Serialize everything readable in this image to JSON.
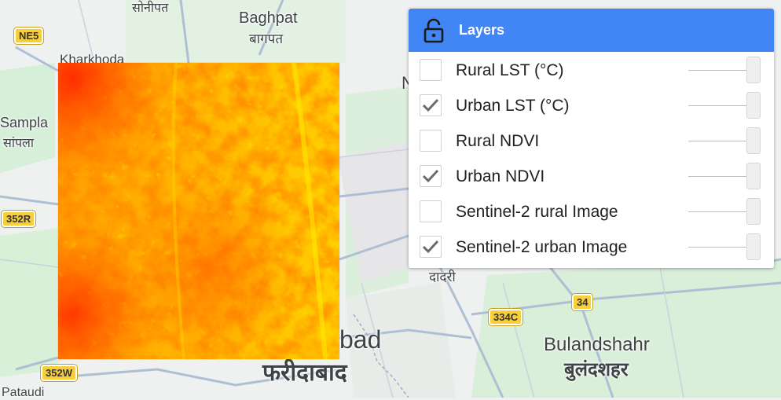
{
  "map": {
    "places": [
      {
        "name": "सोनीपत",
        "id": "sonipat-hi"
      },
      {
        "name": "Baghpat",
        "id": "baghpat"
      },
      {
        "name": "बागपत",
        "id": "baghpat-hi"
      },
      {
        "name": "Kharkhoda",
        "id": "kharkhoda"
      },
      {
        "name": "Sampla",
        "id": "sampla"
      },
      {
        "name": "सांपला",
        "id": "sampla-hi"
      },
      {
        "name": "Pataudi",
        "id": "pataudi"
      },
      {
        "name": "bad",
        "id": "faridabad-partial"
      },
      {
        "name": "फरीदाबाद",
        "id": "faridabad-hi"
      },
      {
        "name": "दादरी",
        "id": "dadri-hi"
      },
      {
        "name": "Bulandshahr",
        "id": "bulandshahr"
      },
      {
        "name": "बुलंदशहर",
        "id": "bulandshahr-hi"
      },
      {
        "name": "N",
        "id": "partial-n"
      }
    ],
    "shields": [
      "NE5",
      "352R",
      "352W",
      "334C",
      "34"
    ],
    "raster_colors": [
      "#ff1a00",
      "#ff7a00",
      "#ffb000",
      "#ffe000",
      "#fff200"
    ]
  },
  "layers_panel": {
    "title": "Layers",
    "header_color": "#4285f4",
    "layers": [
      {
        "label": "Rural LST (°C)",
        "checked": false
      },
      {
        "label": "Urban LST (°C)",
        "checked": true
      },
      {
        "label": "Rural NDVI",
        "checked": false
      },
      {
        "label": "Urban NDVI",
        "checked": true
      },
      {
        "label": "Sentinel-2 rural Image",
        "checked": false
      },
      {
        "label": "Sentinel-2 urban Image",
        "checked": true
      }
    ]
  }
}
